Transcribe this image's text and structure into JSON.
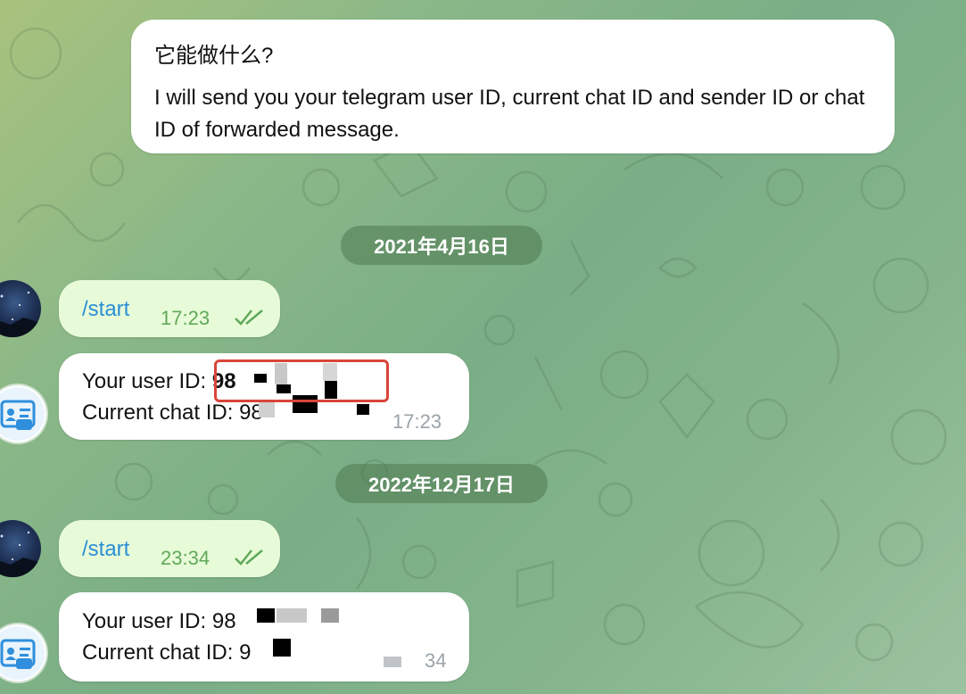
{
  "intro": {
    "title": "它能做什么?",
    "body": "I will send you your telegram user ID, current chat ID and sender ID or chat ID of forwarded message."
  },
  "chat": [
    {
      "date": "2021年4月16日",
      "command": "/start",
      "command_time": "17:23",
      "reply_user_id_label": "Your user ID: ",
      "reply_user_id_value": "98",
      "reply_chat_id_label": "Current chat ID: ",
      "reply_chat_id_value": "98",
      "reply_time": "17:23"
    },
    {
      "date": "2022年12月17日",
      "command": "/start",
      "command_time": "23:34",
      "reply_user_id_label": "Your user ID: ",
      "reply_user_id_value": "98",
      "reply_chat_id_label": "Current chat ID: ",
      "reply_chat_id_value": "9",
      "reply_time": "34"
    }
  ],
  "colors": {
    "link": "#2a8fd6",
    "outgoing_time": "#5fa95a",
    "incoming_time": "#9aa3a9",
    "highlight": "#d9453a"
  },
  "icons": [
    "double-check-icon",
    "id-card-icon",
    "starry-sky-avatar"
  ]
}
